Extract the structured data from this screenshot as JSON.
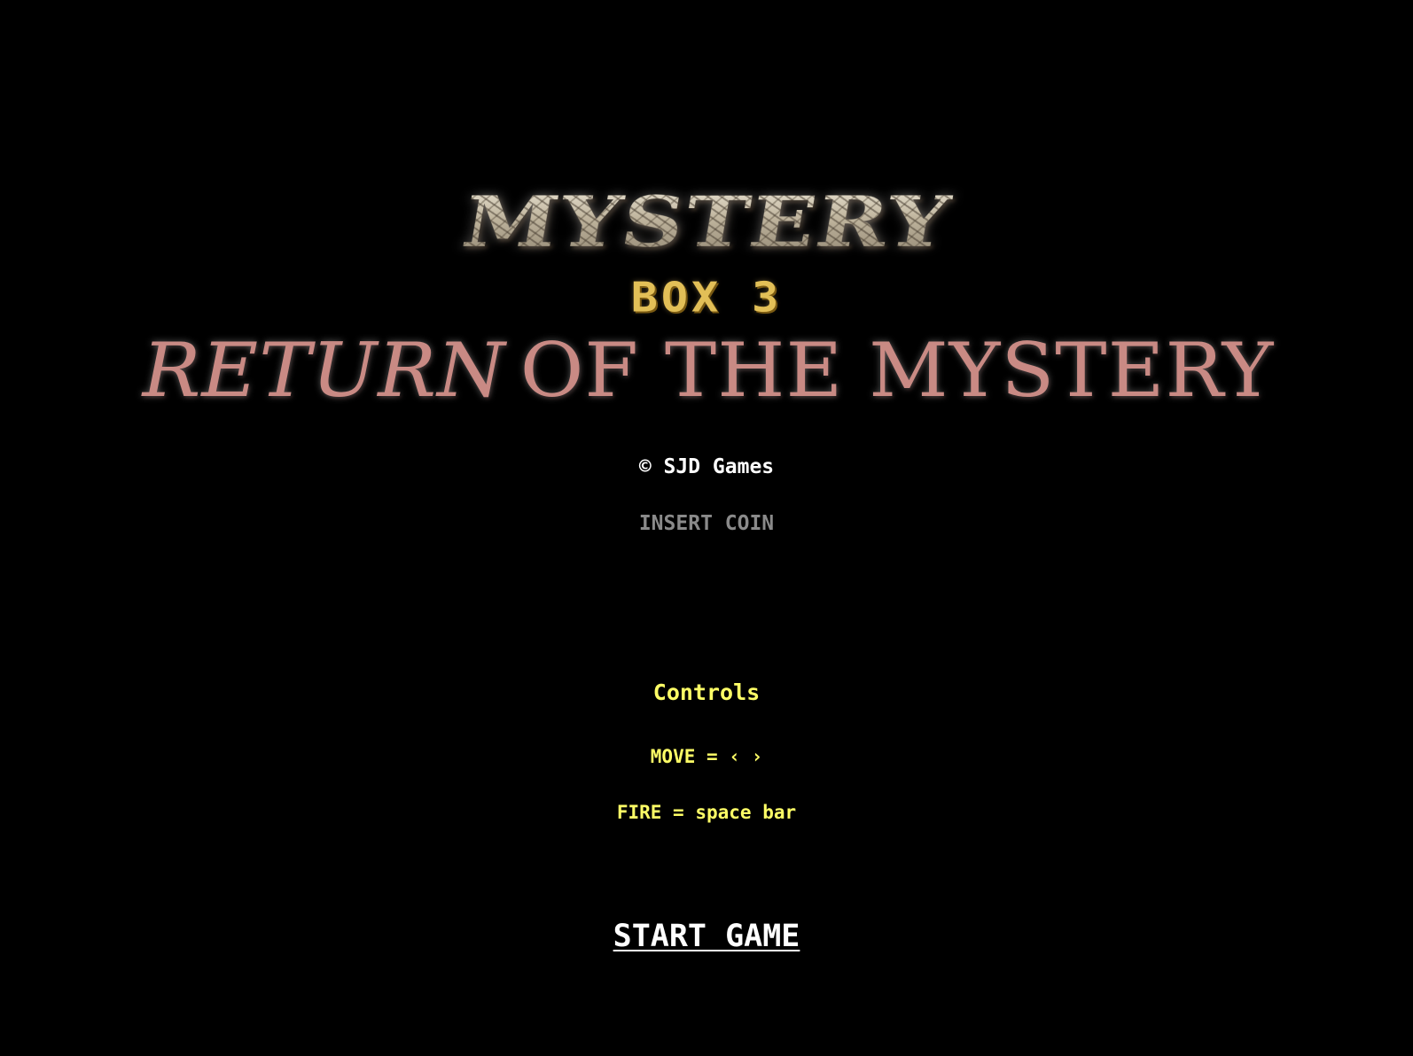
{
  "title_screen": {
    "logo_main": "MYSTERY",
    "logo_box": "BOX 3",
    "subtitle_part1": "RETURN",
    "subtitle_part2": "OF THE MYSTERY",
    "copyright": "© SJD Games",
    "insert_coin": "INSERT COIN"
  },
  "controls": {
    "heading": "Controls",
    "move": "MOVE = ‹ ›",
    "fire": "FIRE = space bar"
  },
  "start_button": {
    "label": "START GAME"
  },
  "colors": {
    "background": "#000000",
    "logo_stone": "#cfc5b0",
    "box_gold": "#e2bf57",
    "subtitle_rose": "#c98a84",
    "controls_yellow": "#ffff66",
    "insert_coin_gray": "#8a8a8a",
    "white": "#ffffff"
  }
}
